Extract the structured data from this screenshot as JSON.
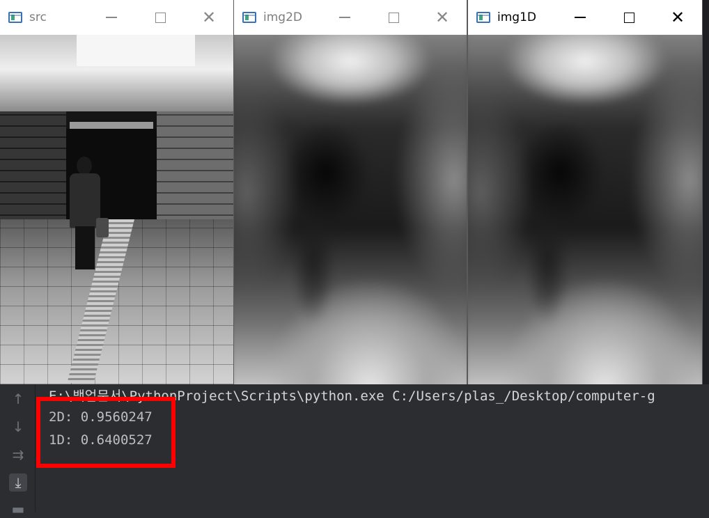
{
  "windows": [
    {
      "title": "src",
      "minimize": "minimize",
      "maximize": "maximize",
      "close": "✕"
    },
    {
      "title": "img2D",
      "minimize": "minimize",
      "maximize": "maximize",
      "close": "✕"
    },
    {
      "title": "img1D",
      "minimize": "minimize",
      "maximize": "maximize",
      "close": "✕"
    }
  ],
  "console": {
    "command": "E:\\백업문서\\PythonProject\\Scripts\\python.exe C:/Users/plas_/Desktop/computer-g",
    "lines": [
      "2D: 0.9560247",
      "1D: 0.6400527"
    ],
    "gutter_icons": [
      "arrow-up-icon",
      "arrow-down-icon",
      "soft-wrap-icon",
      "scroll-to-end-icon",
      "print-icon"
    ]
  },
  "colors": {
    "highlight": "#ff0000",
    "console_bg": "#2b2d30",
    "console_text": "#bcbec4"
  }
}
